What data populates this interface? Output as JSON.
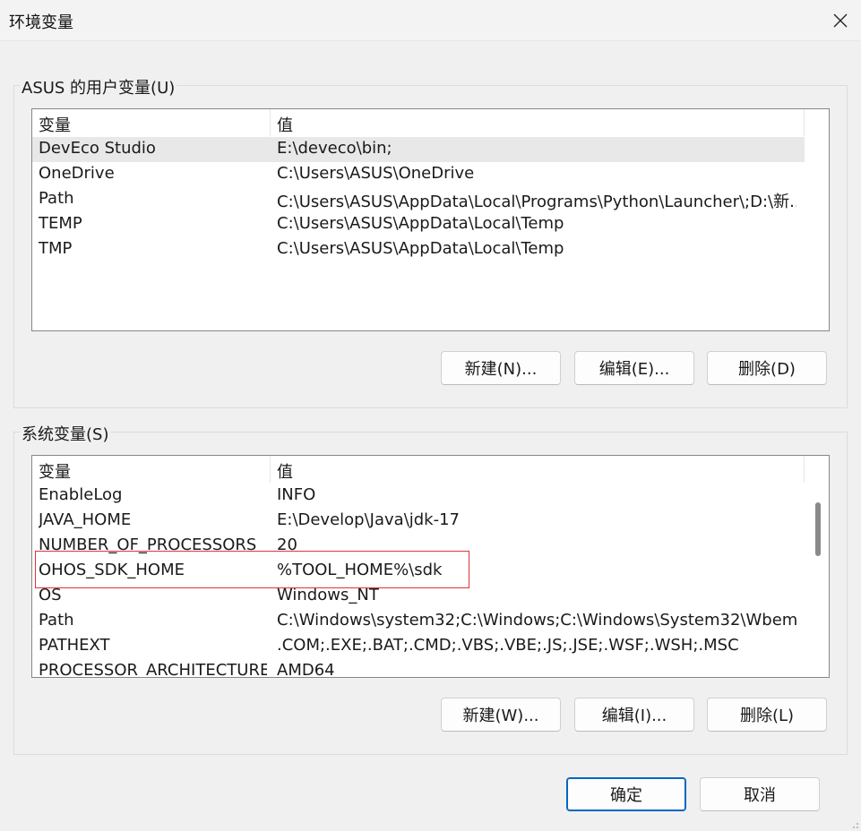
{
  "window": {
    "title": "环境变量",
    "close_icon": "close-icon"
  },
  "user_vars": {
    "group_label": "ASUS 的用户变量(U)",
    "headers": {
      "name": "变量",
      "value": "值"
    },
    "rows": [
      {
        "name": "DevEco Studio",
        "value": "E:\\deveco\\bin;",
        "selected": true
      },
      {
        "name": "OneDrive",
        "value": "C:\\Users\\ASUS\\OneDrive"
      },
      {
        "name": "Path",
        "value": "C:\\Users\\ASUS\\AppData\\Local\\Programs\\Python\\Launcher\\;D:\\新..."
      },
      {
        "name": "TEMP",
        "value": "C:\\Users\\ASUS\\AppData\\Local\\Temp"
      },
      {
        "name": "TMP",
        "value": "C:\\Users\\ASUS\\AppData\\Local\\Temp"
      }
    ],
    "buttons": {
      "new": "新建(N)...",
      "edit": "编辑(E)...",
      "delete": "删除(D)"
    }
  },
  "system_vars": {
    "group_label": "系统变量(S)",
    "headers": {
      "name": "变量",
      "value": "值"
    },
    "rows": [
      {
        "name": "EnableLog",
        "value": "INFO"
      },
      {
        "name": "JAVA_HOME",
        "value": "E:\\Develop\\Java\\jdk-17"
      },
      {
        "name": "NUMBER_OF_PROCESSORS",
        "value": "20"
      },
      {
        "name": "OHOS_SDK_HOME",
        "value": "%TOOL_HOME%\\sdk",
        "highlighted": true
      },
      {
        "name": "OS",
        "value": "Windows_NT"
      },
      {
        "name": "Path",
        "value": "C:\\Windows\\system32;C:\\Windows;C:\\Windows\\System32\\Wbem;..."
      },
      {
        "name": "PATHEXT",
        "value": ".COM;.EXE;.BAT;.CMD;.VBS;.VBE;.JS;.JSE;.WSF;.WSH;.MSC"
      },
      {
        "name": "PROCESSOR_ARCHITECTURE",
        "value": "AMD64"
      }
    ],
    "buttons": {
      "new": "新建(W)...",
      "edit": "编辑(I)...",
      "delete": "删除(L)"
    }
  },
  "footer": {
    "ok": "确定",
    "cancel": "取消"
  },
  "colors": {
    "accent": "#0067c0",
    "highlight": "#e0323a",
    "selected_row": "#e8e8e8"
  }
}
